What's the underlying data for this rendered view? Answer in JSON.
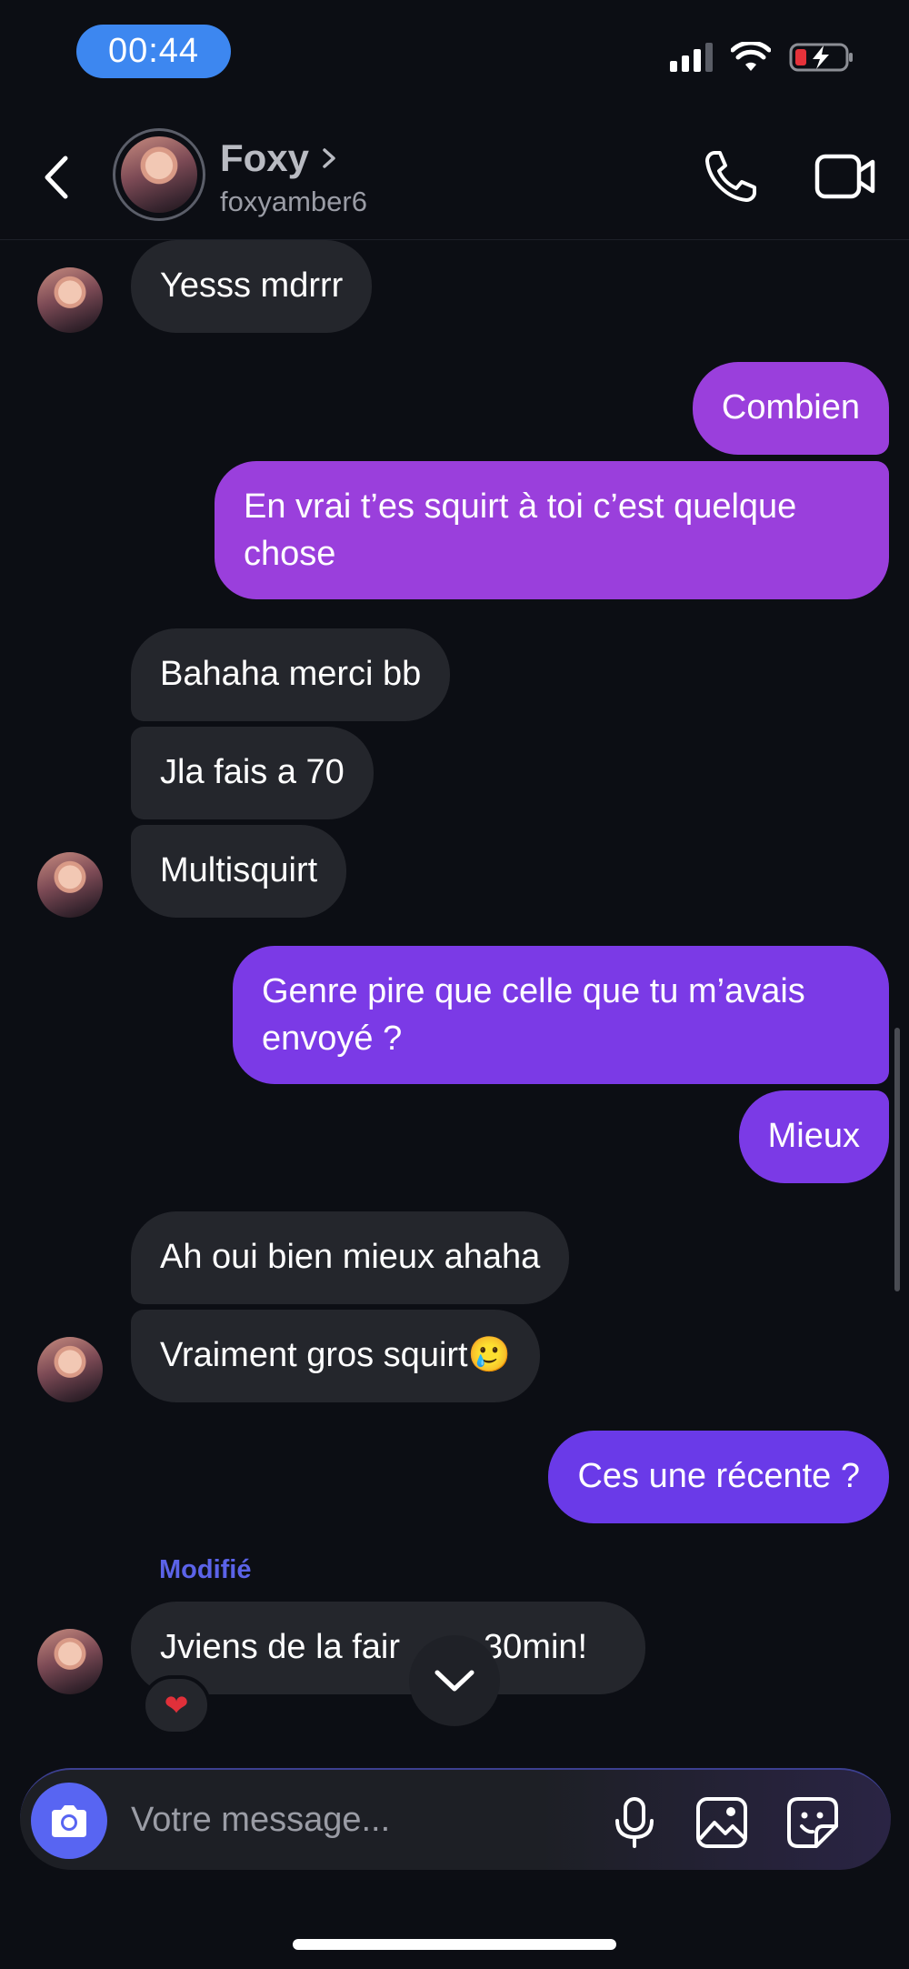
{
  "status_bar": {
    "time": "00:44",
    "battery_color": "#e5323a"
  },
  "header": {
    "name": "Foxy",
    "username": "foxyamber6",
    "icons": {
      "back": "chevron-left-icon",
      "name_arrow": "chevron-right-icon",
      "call": "phone-icon",
      "video": "video-camera-icon"
    }
  },
  "messages": [
    {
      "side": "in",
      "text": "Yesss mdrrr"
    },
    {
      "side": "out",
      "text": "Combien"
    },
    {
      "side": "out",
      "text": "En vrai t’es squirt à toi c’est quelque chose"
    },
    {
      "side": "in",
      "text": "Bahaha merci bb"
    },
    {
      "side": "in",
      "text": "Jla fais a 70"
    },
    {
      "side": "in",
      "text": "Multisquirt"
    },
    {
      "side": "out",
      "text": "Genre pire que celle que tu m’avais envoyé ?"
    },
    {
      "side": "out",
      "text": "Mieux"
    },
    {
      "side": "in",
      "text": "Ah oui bien mieux ahaha"
    },
    {
      "side": "in",
      "text": "Vraiment gros squirt",
      "emoji": "🥲"
    },
    {
      "side": "out",
      "text": "Ces une récente ?"
    },
    {
      "side": "in",
      "text": "Jviens de la fair",
      "text_tail": "30min!",
      "edited_label": "Modifié",
      "reaction": "❤"
    }
  ],
  "composer": {
    "placeholder": "Votre message...",
    "icons": {
      "camera": "camera-icon",
      "mic": "microphone-icon",
      "gallery": "image-icon",
      "sticker": "sticker-icon"
    }
  },
  "colors": {
    "outgoing_1": "#9a3fdc",
    "outgoing_2": "#7b3ae6",
    "outgoing_3": "#6a3ae8",
    "incoming": "#24262c",
    "accent": "#5865f2"
  }
}
